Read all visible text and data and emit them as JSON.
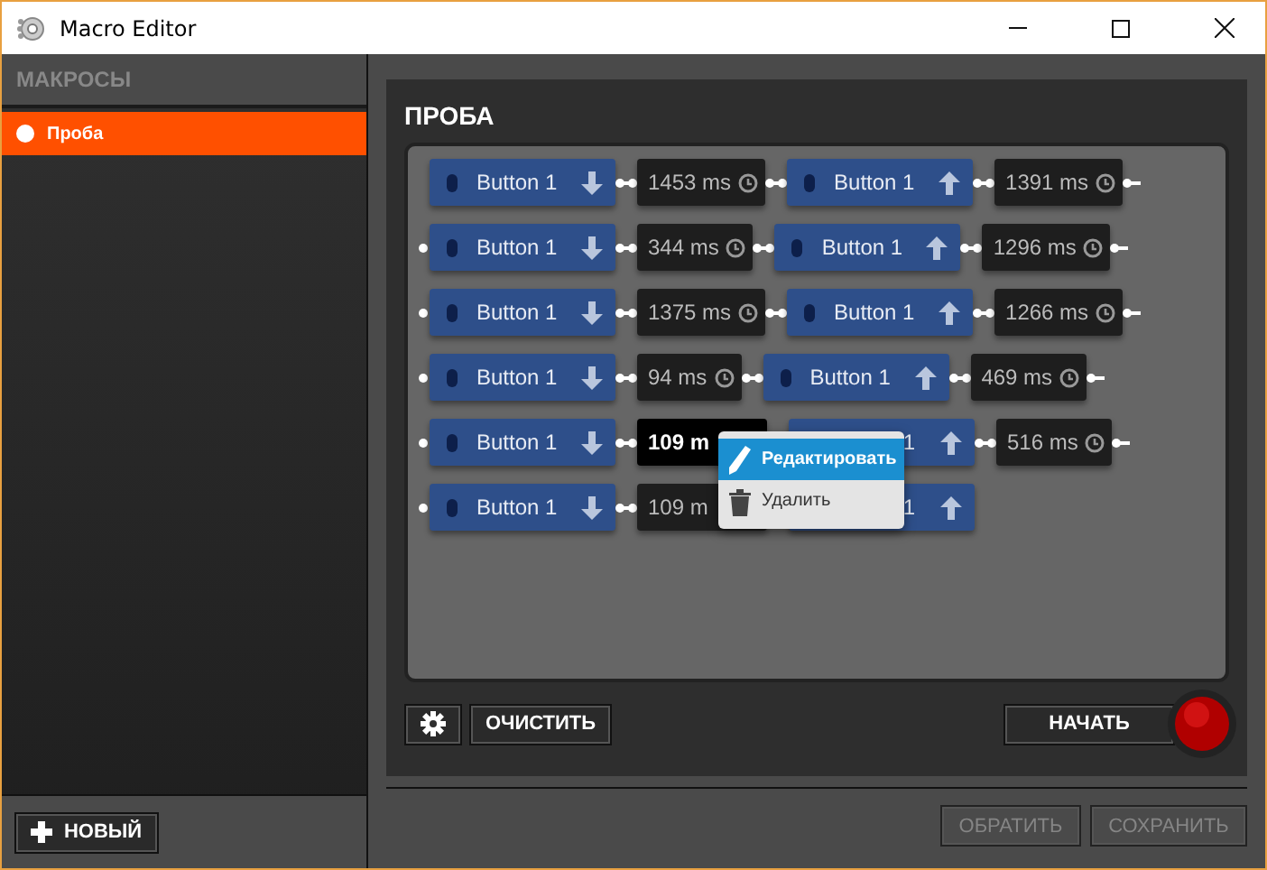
{
  "window": {
    "title": "Macro Editor"
  },
  "sidebar": {
    "header": "МАКРОСЫ",
    "items": [
      {
        "label": "Проба",
        "selected": true
      }
    ],
    "new_button": "НОВЫЙ"
  },
  "macro": {
    "title": "ПРОБА",
    "rows": [
      [
        {
          "kind": "key_down",
          "label": "Button 1",
          "selected": false,
          "covered": false
        },
        {
          "kind": "delay",
          "text": "1453 ms",
          "selected": false,
          "covered": false
        },
        {
          "kind": "key_up",
          "label": "Button 1",
          "selected": false,
          "covered": false
        },
        {
          "kind": "delay",
          "text": "1391 ms",
          "selected": false,
          "covered": false
        }
      ],
      [
        {
          "kind": "key_down",
          "label": "Button 1",
          "selected": false,
          "covered": false
        },
        {
          "kind": "delay",
          "text": "344 ms",
          "selected": false,
          "covered": false
        },
        {
          "kind": "key_up",
          "label": "Button 1",
          "selected": false,
          "covered": false
        },
        {
          "kind": "delay",
          "text": "1296 ms",
          "selected": false,
          "covered": false
        }
      ],
      [
        {
          "kind": "key_down",
          "label": "Button 1",
          "selected": false,
          "covered": false
        },
        {
          "kind": "delay",
          "text": "1375 ms",
          "selected": false,
          "covered": false
        },
        {
          "kind": "key_up",
          "label": "Button 1",
          "selected": false,
          "covered": false
        },
        {
          "kind": "delay",
          "text": "1266 ms",
          "selected": false,
          "covered": false
        }
      ],
      [
        {
          "kind": "key_down",
          "label": "Button 1",
          "selected": false,
          "covered": false
        },
        {
          "kind": "delay",
          "text": "94 ms",
          "selected": false,
          "covered": false
        },
        {
          "kind": "key_up",
          "label": "Button 1",
          "selected": false,
          "covered": false
        },
        {
          "kind": "delay",
          "text": "469 ms",
          "selected": false,
          "covered": false
        }
      ],
      [
        {
          "kind": "key_down",
          "label": "Button 1",
          "selected": false,
          "covered": false
        },
        {
          "kind": "delay",
          "text": "109 m",
          "selected": true,
          "covered": true
        },
        {
          "kind": "key_up",
          "label": "1",
          "selected": false,
          "covered": true
        },
        {
          "kind": "delay",
          "text": "516 ms",
          "selected": false,
          "covered": false
        }
      ],
      [
        {
          "kind": "key_down",
          "label": "Button 1",
          "selected": false,
          "covered": false
        },
        {
          "kind": "delay",
          "text": "109 m",
          "selected": false,
          "covered": true
        },
        {
          "kind": "key_up",
          "label": "1",
          "selected": false,
          "covered": true
        }
      ]
    ],
    "context_menu": [
      {
        "kind": "edit",
        "label": "Редактировать",
        "selected": true
      },
      {
        "kind": "delete",
        "label": "Удалить",
        "selected": false
      }
    ],
    "clear_button": "ОЧИСТИТЬ",
    "start_button": "НАЧАТЬ"
  },
  "footer": {
    "buttons": [
      {
        "label": "ОБРАТИТЬ",
        "disabled": true
      },
      {
        "label": "СОХРАНИТЬ",
        "disabled": true
      }
    ]
  }
}
